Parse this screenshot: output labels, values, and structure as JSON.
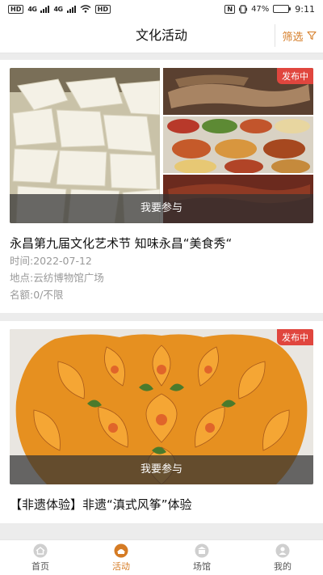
{
  "status_bar": {
    "sim1": "HD",
    "sim2": "HD",
    "signal1": "4G",
    "signal2": "4G",
    "nfc": "N",
    "battery_text": "47%",
    "battery_level": 0.47,
    "time": "9:11"
  },
  "header": {
    "title": "文化活动",
    "filter_label": "筛选",
    "filter_icon": "funnel-icon",
    "accent_color": "#d57b24"
  },
  "cards": [
    {
      "badge": "发布中",
      "join_label": "我要参与",
      "title": "永昌第九届文化艺术节 知味永昌“美食秀“",
      "time": "时间:2022-07-12",
      "location": "地点:云纺博物馆广场",
      "quota": "名额:0/不限"
    },
    {
      "badge": "发布中",
      "join_label": "我要参与",
      "title": "【非遗体验】非遗“滇式风筝”体验"
    }
  ],
  "tabbar": {
    "items": [
      {
        "label": "首页",
        "icon": "home-icon",
        "active": false
      },
      {
        "label": "活动",
        "icon": "activity-icon",
        "active": true
      },
      {
        "label": "场馆",
        "icon": "venue-icon",
        "active": false
      },
      {
        "label": "我的",
        "icon": "profile-icon",
        "active": false
      }
    ]
  },
  "colors": {
    "accent": "#d57b24",
    "badge": "#e0463e"
  }
}
